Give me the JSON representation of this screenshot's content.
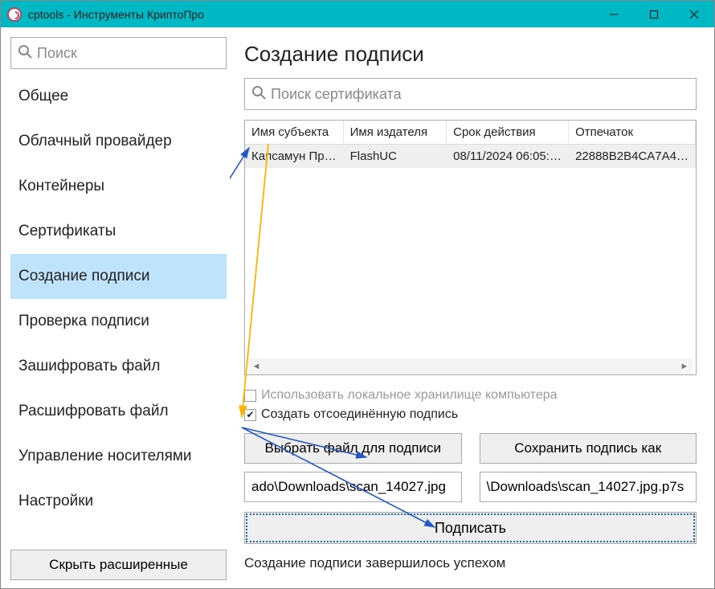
{
  "window": {
    "title": "cptools - Инструменты КриптоПро"
  },
  "sidebar": {
    "search_placeholder": "Поиск",
    "items": [
      "Общее",
      "Облачный провайдер",
      "Контейнеры",
      "Сертификаты",
      "Создание подписи",
      "Проверка подписи",
      "Зашифровать файл",
      "Расшифровать файл",
      "Управление носителями",
      "Настройки"
    ],
    "active_index": 4,
    "hide_advanced": "Скрыть расширенные"
  },
  "main": {
    "heading": "Создание подписи",
    "cert_search_placeholder": "Поиск сертификата",
    "table": {
      "headers": [
        "Имя субъекта",
        "Имя издателя",
        "Срок действия",
        "Отпечаток"
      ],
      "row": {
        "subject": "Капсамун Пр…",
        "issuer": "FlashUC",
        "validity": "08/11/2024 06:05:…",
        "thumbprint": "22888B2B4CA7A4…"
      }
    },
    "checks": {
      "use_local_store": "Использовать локальное хранилище компьютера",
      "detached": "Создать отсоединённую подпись"
    },
    "buttons": {
      "choose_file": "Выбрать файл для подписи",
      "save_as": "Сохранить подпись как",
      "sign": "Подписать"
    },
    "fields": {
      "input_path": "ado\\Downloads\\scan_14027.jpg",
      "output_path": "\\Downloads\\scan_14027.jpg.p7s"
    },
    "status": "Создание подписи завершилось успехом"
  }
}
